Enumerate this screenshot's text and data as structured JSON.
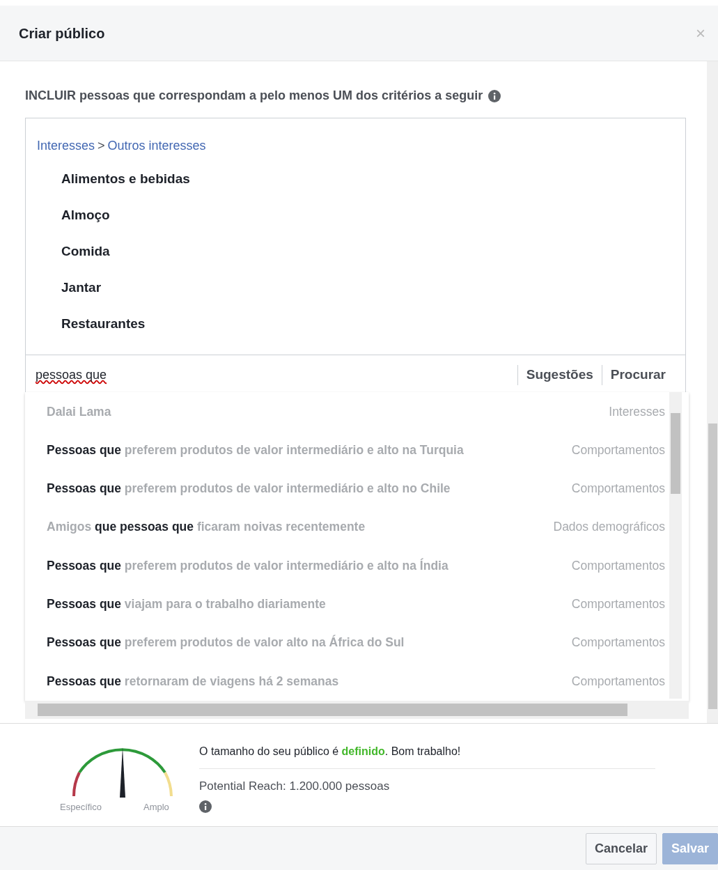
{
  "dialog": {
    "title": "Criar público",
    "close": "×"
  },
  "include_label": "INCLUIR pessoas que correspondam a pelo menos UM dos critérios a seguir",
  "breadcrumb": [
    "Interesses",
    "Outros interesses"
  ],
  "breadcrumb_separator": ">",
  "selected_interests": [
    "Alimentos e bebidas",
    "Almoço",
    "Comida",
    "Jantar",
    "Restaurantes"
  ],
  "search": {
    "value": "pessoas que",
    "links": [
      "Sugestões",
      "Procurar"
    ]
  },
  "suggestions": [
    {
      "text": "Dalai Lama",
      "category": "Interesses"
    },
    {
      "text": "**Pessoas que** preferem produtos de valor intermediário e alto na Turquia",
      "category": "Comportamentos"
    },
    {
      "text": "**Pessoas que** preferem produtos de valor intermediário e alto no Chile",
      "category": "Comportamentos"
    },
    {
      "text": "Amigos **que pessoas que** ficaram noivas recentemente",
      "category": "Dados demográficos"
    },
    {
      "text": "**Pessoas que** preferem produtos de valor intermediário e alto na Índia",
      "category": "Comportamentos"
    },
    {
      "text": "**Pessoas que** viajam para o trabalho diariamente",
      "category": "Comportamentos"
    },
    {
      "text": "**Pessoas que** preferem produtos de valor alto na África do Sul",
      "category": "Comportamentos"
    },
    {
      "text": "**Pessoas que** retornaram de viagens há 2 semanas",
      "category": "Comportamentos"
    }
  ],
  "audience": {
    "gauge_labels": [
      "Específico",
      "Amplo"
    ],
    "status": "O tamanho do seu público é **definido**. Bom trabalho!",
    "reach": "Potential Reach: 1.200.000 pessoas"
  },
  "buttons": [
    {
      "label": "Cancelar",
      "kind": "secondary",
      "disabled": false
    },
    {
      "label": "Salvar",
      "kind": "primary",
      "disabled": true
    }
  ]
}
